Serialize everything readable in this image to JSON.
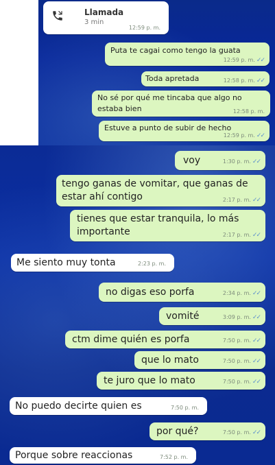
{
  "call": {
    "title": "Llamada",
    "duration": "3 min",
    "time": "12:59 p. m."
  },
  "top_messages": [
    {
      "text": "Puta te cagai como tengo la guata",
      "time": "12:59 p. m."
    },
    {
      "text": "Toda apretada",
      "time": "12:58 p. m."
    },
    {
      "text_line1": "No sé por qué me tincaba que algo no",
      "text_line2": "estaba bien",
      "time": "12:58 p. m."
    },
    {
      "text": "Estuve a punto de subir de hecho",
      "time": "12:59 p. m."
    }
  ],
  "bottom_messages": [
    {
      "text": "voy",
      "time": "1:30 p. m.",
      "dir": "out"
    },
    {
      "text_line1": "tengo ganas de vomitar, que ganas de",
      "text_line2": "estar ahí contigo",
      "time": "2:17 p. m.",
      "dir": "out"
    },
    {
      "text_line1": "tienes que estar tranquila, lo más",
      "text_line2": "importante",
      "time": "2:17 p. m.",
      "dir": "out"
    },
    {
      "text": "Me siento muy tonta",
      "time": "2:23 p. m.",
      "dir": "in"
    },
    {
      "text": "no digas eso porfa",
      "time": "2:34 p. m.",
      "dir": "out"
    },
    {
      "text": "vomité",
      "time": "3:09 p. m.",
      "dir": "out"
    },
    {
      "text": "ctm dime quién es porfa",
      "time": "7:50 p. m.",
      "dir": "out"
    },
    {
      "text": "que lo mato",
      "time": "7:50 p. m.",
      "dir": "out"
    },
    {
      "text": "te juro que lo mato",
      "time": "7:50 p. m.",
      "dir": "out"
    },
    {
      "text": "No puedo decirte quien es",
      "time": "7:50 p. m.",
      "dir": "in"
    },
    {
      "text": "por qué?",
      "time": "7:50 p. m.",
      "dir": "out"
    },
    {
      "text": "Porque sobre reaccionas",
      "time": "7:52 p. m.",
      "dir": "in"
    }
  ],
  "ticks": "✓✓",
  "colors": {
    "outgoing_bubble": "#dcf6c0",
    "incoming_bubble": "#ffffff",
    "wallpaper": "#0b2b95",
    "read_ticks": "#5b8fcc"
  }
}
